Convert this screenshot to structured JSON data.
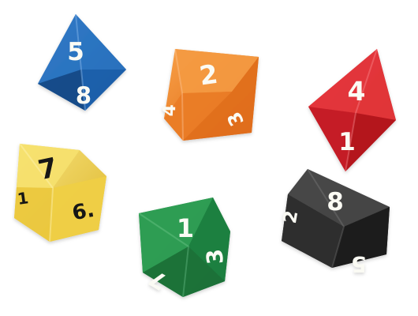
{
  "dice": [
    {
      "id": "blue",
      "color": "#1f63b3",
      "numbers": [
        "5",
        "8"
      ]
    },
    {
      "id": "orange",
      "color": "#f07b1f",
      "numbers": [
        "2",
        "4",
        "3"
      ]
    },
    {
      "id": "red",
      "color": "#d8272d",
      "numbers": [
        "4",
        "1"
      ]
    },
    {
      "id": "yellow",
      "color": "#f2d34d",
      "numbers": [
        "7",
        "6.",
        "1"
      ]
    },
    {
      "id": "green",
      "color": "#1f8c45",
      "numbers": [
        "1",
        "7",
        "3"
      ]
    },
    {
      "id": "black",
      "color": "#272727",
      "numbers": [
        "8",
        "2",
        "5"
      ]
    }
  ],
  "background": "#ffffff"
}
